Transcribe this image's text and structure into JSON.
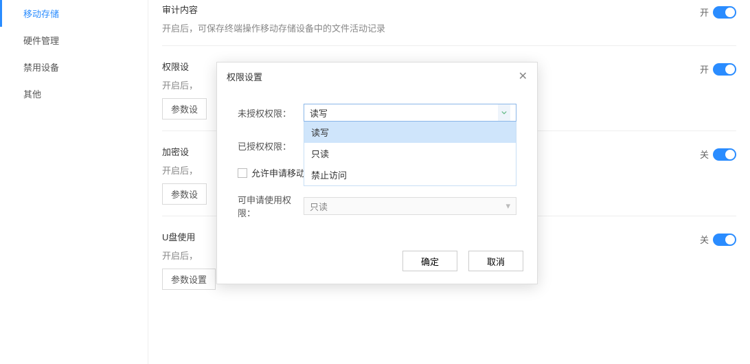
{
  "sidebar": {
    "items": [
      {
        "label": "移动存储",
        "active": true
      },
      {
        "label": "硬件管理"
      },
      {
        "label": "禁用设备"
      },
      {
        "label": "其他"
      }
    ]
  },
  "sections": {
    "audit": {
      "title": "审计内容",
      "desc": "开启后，可保存终端操作移动存储设备中的文件活动记录",
      "toggle_text": "开"
    },
    "perm": {
      "title": "权限设",
      "desc_prefix": "开启后，",
      "btn": "参数设",
      "toggle_text": "开"
    },
    "encrypt": {
      "title": "加密设",
      "desc_prefix": "开启后，",
      "btn": "参数设",
      "toggle_text": "关"
    },
    "udisk": {
      "title": "U盘使用",
      "desc_prefix": "开启后，",
      "btn": "参数设置",
      "toggle_text": "关"
    }
  },
  "modal": {
    "title": "权限设置",
    "unauth_label": "未授权权限：",
    "authed_label": "已授权权限：",
    "unauth_value": "读写",
    "options": [
      "读写",
      "只读",
      "禁止访问"
    ],
    "allow_apply_label": "允许申请移动存储使用审批",
    "applicable_label": "可申请使用权限：",
    "applicable_value": "只读",
    "ok": "确定",
    "cancel": "取消"
  }
}
